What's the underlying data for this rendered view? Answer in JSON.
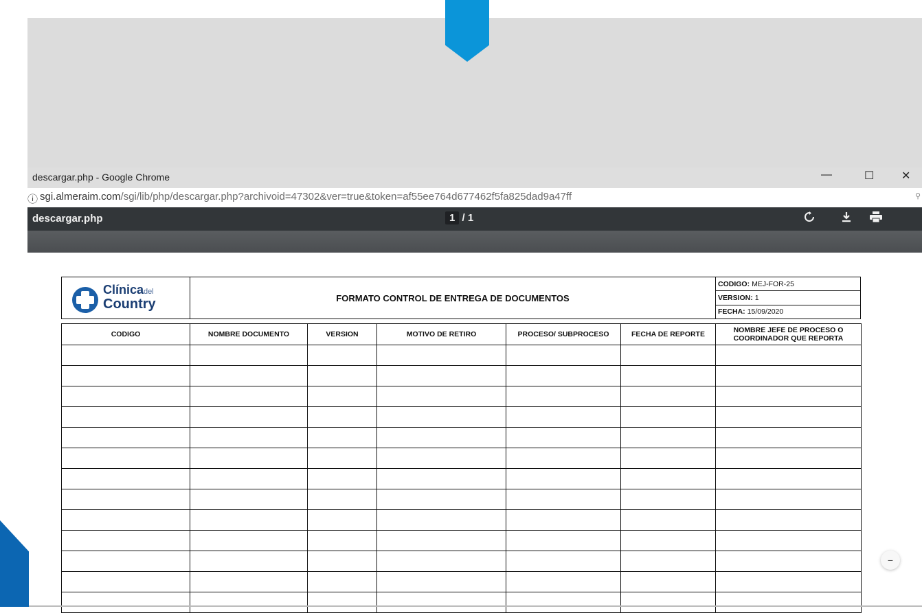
{
  "window": {
    "title": "descargar.php - Google Chrome",
    "minimize": "—",
    "maximize": "☐",
    "close": "✕"
  },
  "address_bar": {
    "host": "sgi.almeraim.com",
    "path": "/sgi/lib/php/descargar.php?archivoid=47302&ver=true&token=af55ee764d677462f5fa825dad9a47ff"
  },
  "pdf_viewer": {
    "file_name": "descargar.php",
    "page_current": "1",
    "page_separator": "/",
    "page_total": "1",
    "icons": [
      "rotate-icon",
      "download-icon",
      "print-icon"
    ]
  },
  "document": {
    "logo": {
      "line1": "Clínica",
      "line1_small": "del",
      "line2": "Country",
      "cross_color": "#1b5fa8"
    },
    "title": "FORMATO CONTROL DE ENTREGA DE DOCUMENTOS",
    "meta": [
      {
        "label": "CODIGO:",
        "value": "MEJ-FOR-25"
      },
      {
        "label": "VERSION:",
        "value": "1"
      },
      {
        "label": "FECHA:",
        "value": "15/09/2020"
      }
    ],
    "columns": [
      "CODIGO",
      "NOMBRE DOCUMENTO",
      "VERSION",
      "MOTIVO DE RETIRO",
      "PROCESO/ SUBPROCESO",
      "FECHA DE REPORTE",
      "NOMBRE JEFE DE PROCESO O COORDINADOR QUE REPORTA"
    ],
    "empty_rows": 13
  },
  "colors": {
    "accent_top": "#0b95d9",
    "accent_bottom": "#0c66b2",
    "pdf_toolbar": "#323639"
  }
}
